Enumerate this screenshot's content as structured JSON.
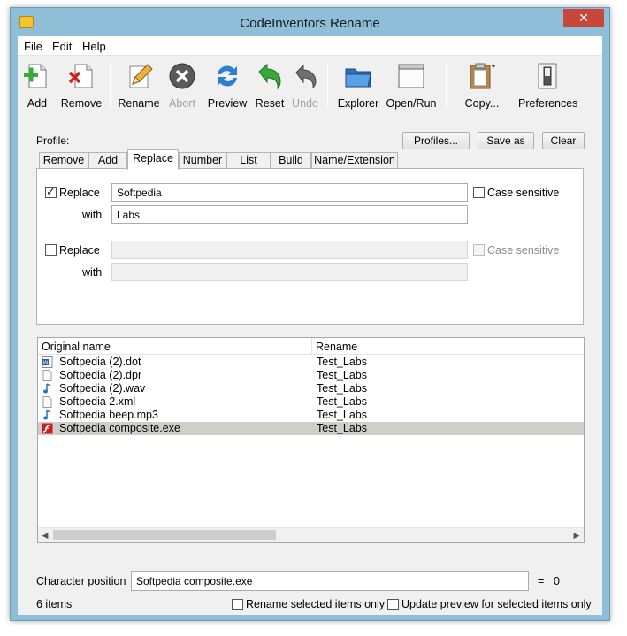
{
  "window": {
    "title": "CodeInventors Rename",
    "close_glyph": "✕"
  },
  "menu": [
    {
      "label": "File"
    },
    {
      "label": "Edit"
    },
    {
      "label": "Help"
    }
  ],
  "toolbar": {
    "add": "Add",
    "remove": "Remove",
    "rename": "Rename",
    "abort": "Abort",
    "preview": "Preview",
    "reset": "Reset",
    "undo": "Undo",
    "explorer": "Explorer",
    "open_run": "Open/Run",
    "copy": "Copy...",
    "preferences": "Preferences"
  },
  "profile": {
    "label": "Profile:",
    "profiles_button": "Profiles...",
    "save_as_button": "Save as",
    "clear_button": "Clear"
  },
  "tabs": [
    "Remove",
    "Add",
    "Replace",
    "Number",
    "List",
    "Build",
    "Name/Extension"
  ],
  "active_tab": "Replace",
  "replace": {
    "row1": {
      "checked": true,
      "replace_label": "Replace",
      "replace_value": "Softpedia",
      "with_label": "with",
      "with_value": "Labs",
      "case_label": "Case sensitive"
    },
    "row2": {
      "checked": false,
      "replace_label": "Replace",
      "replace_value": "",
      "with_label": "with",
      "with_value": "",
      "case_label": "Case sensitive"
    }
  },
  "file_list": {
    "columns": {
      "original": "Original name",
      "rename": "Rename"
    },
    "rows": [
      {
        "name": "Softpedia (2).dot",
        "rename": "Test_Labs",
        "icon": "word-document-icon"
      },
      {
        "name": "Softpedia (2).dpr",
        "rename": "Test_Labs",
        "icon": "blank-file-icon"
      },
      {
        "name": "Softpedia (2).wav",
        "rename": "Test_Labs",
        "icon": "audio-file-icon"
      },
      {
        "name": "Softpedia 2.xml",
        "rename": "Test_Labs",
        "icon": "blank-file-icon"
      },
      {
        "name": "Softpedia beep.mp3",
        "rename": "Test_Labs",
        "icon": "audio-file-icon"
      },
      {
        "name": "Softpedia composite.exe",
        "rename": "Test_Labs",
        "icon": "flash-exe-icon",
        "selected": true
      }
    ]
  },
  "character_position": {
    "label": "Character position",
    "value": "Softpedia composite.exe",
    "equals": "=",
    "number": "0"
  },
  "status": {
    "count": "6 items",
    "rename_selected_label": "Rename selected items only",
    "update_preview_label": "Update preview for selected items only"
  },
  "colors": {
    "window_frame": "#8fbfd8",
    "close_button": "#c7483a",
    "selection": "#cfcfc8"
  }
}
